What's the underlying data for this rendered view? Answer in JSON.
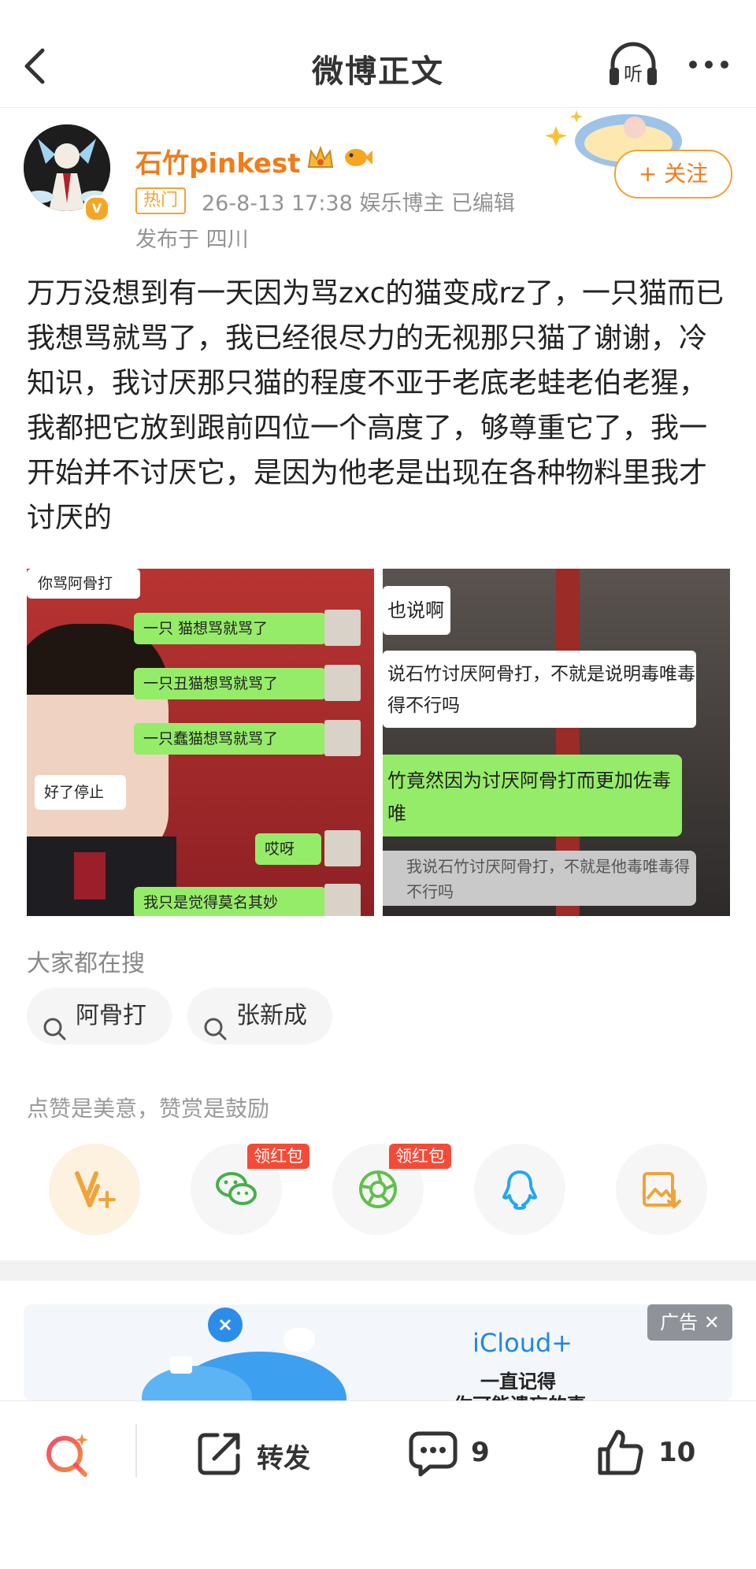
{
  "header": {
    "title": "微博正文",
    "listen_label": "听"
  },
  "author": {
    "name": "石竹pinkest",
    "hot_tag": "热门",
    "meta": "26-8-13 17:38  娱乐博主  已编辑",
    "location": "发布于 四川",
    "follow_label": "+ 关注"
  },
  "post": {
    "text": "万万没想到有一天因为骂zxc的猫变成rz了，一只猫而已我想骂就骂了，我已经很尽力的无视那只猫了谢谢，冷知识，我讨厌那只猫的程度不亚于老底老蛙老伯老猩，我都把它放到跟前四位一个高度了，够尊重它了，我一开始并不讨厌它，是因为他老是出现在各种物料里我才讨厌的",
    "image_left": {
      "header_label": "你骂阿骨打",
      "bubbles": [
        "一只   猫想骂就骂了",
        "一只丑猫想骂就骂了",
        "一只蠢猫想骂就骂了",
        "哎呀",
        "我只是觉得莫名其妙"
      ],
      "white_bubble": "好了停止"
    },
    "image_right": {
      "top_label": "也说啊",
      "white_text": "说石竹讨厌阿骨打，不就是说明毒唯毒得不行吗",
      "green_text": "竹竟然因为讨厌阿骨打而更加佐毒唯",
      "grey_text": "我说石竹讨厌阿骨打，不就是他毒唯毒得不行吗"
    }
  },
  "search": {
    "title": "大家都在搜",
    "chips": [
      "阿骨打",
      "张新成"
    ]
  },
  "praise_text": "点赞是美意，赞赏是鼓励",
  "share": {
    "redpack_label": "领红包"
  },
  "ad": {
    "tag": "广告",
    "brand": "iCloud+",
    "line1": "一直记得",
    "line2": "你可能遗忘的事"
  },
  "bottom_bar": {
    "repost_label": "转发",
    "comment_count": "9",
    "like_count": "10"
  },
  "colors": {
    "accent": "#ef7c1b",
    "wechat_green": "#95ec69",
    "redpack": "#f34b37"
  }
}
